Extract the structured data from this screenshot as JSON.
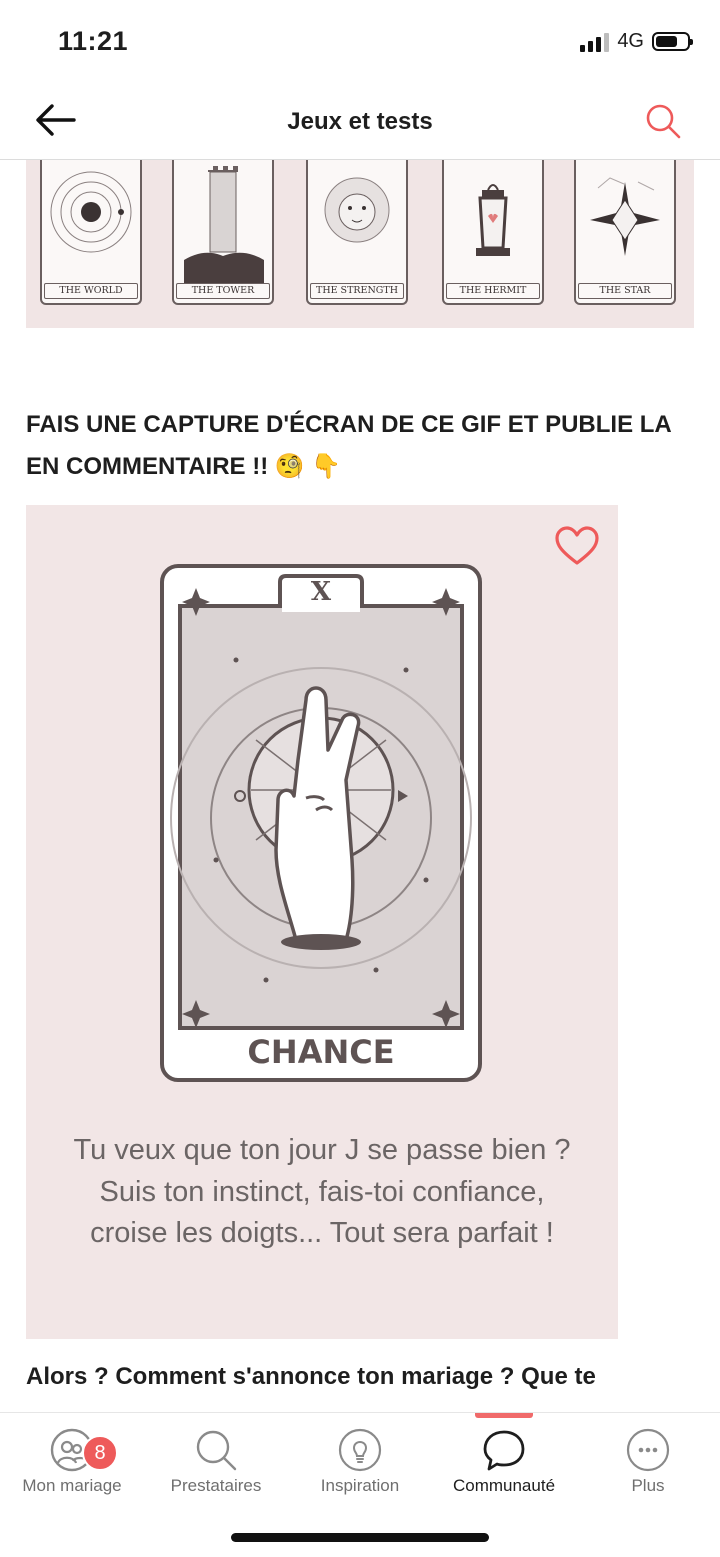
{
  "status": {
    "time": "11:21",
    "network": "4G",
    "battery_level": 0.7
  },
  "header": {
    "title": "Jeux et tests"
  },
  "banner": {
    "cards": [
      "THE WORLD",
      "THE TOWER",
      "THE STRENGTH",
      "THE HERMIT",
      "THE STAR"
    ]
  },
  "post": {
    "heading": "FAIS UNE CAPTURE D'ÉCRAN DE CE GIF ET PUBLIE LA EN COMMENTAIRE !! 🧐 👇",
    "card_numeral": "X",
    "card_title": "CHANCE",
    "caption": "Tu veux que ton jour J se passe bien ? Suis ton instinct, fais-toi confiance, croise les doigts... Tout sera parfait !",
    "teaser": "Alors ? Comment s'annonce ton mariage ? Que te"
  },
  "tabbar": {
    "active": "Communauté",
    "items": [
      {
        "label": "Mon mariage",
        "icon": "wedding-rings-icon",
        "badge": "8"
      },
      {
        "label": "Prestataires",
        "icon": "search-icon"
      },
      {
        "label": "Inspiration",
        "icon": "lightbulb-icon"
      },
      {
        "label": "Communauté",
        "icon": "chat-bubble-icon"
      },
      {
        "label": "Plus",
        "icon": "more-icon"
      }
    ]
  },
  "colors": {
    "accent": "#ee5a5a",
    "panel": "#f2e6e6",
    "ink": "#5e5353"
  }
}
